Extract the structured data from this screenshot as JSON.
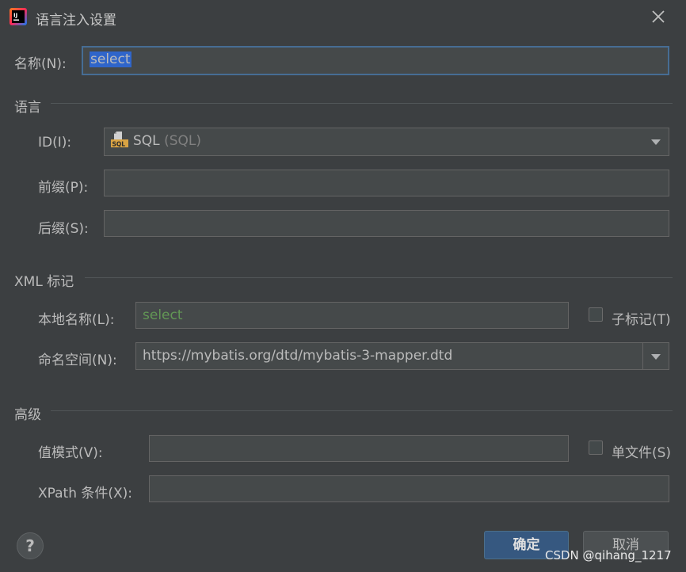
{
  "window": {
    "title": "语言注入设置",
    "app_icon": "intellij-idea-icon",
    "close_icon": "close-icon"
  },
  "name_row": {
    "label": "名称(N):",
    "value": "select",
    "value_selected": true
  },
  "language_section": {
    "title": "语言",
    "id_label": "ID(I):",
    "id_value_name": "SQL",
    "id_value_detail": "(SQL)",
    "id_icon": "sql-file-icon",
    "prefix_label": "前缀(P):",
    "prefix_value": "",
    "suffix_label": "后缀(S):",
    "suffix_value": ""
  },
  "xml_section": {
    "title": "XML 标记",
    "local_name_label": "本地名称(L):",
    "local_name_value": "select",
    "sub_tags_label": "子标记(T)",
    "sub_tags_checked": false,
    "namespace_label": "命名空间(N):",
    "namespace_value": "https://mybatis.org/dtd/mybatis-3-mapper.dtd"
  },
  "advanced_section": {
    "title": "高级",
    "value_pattern_label": "值模式(V):",
    "value_pattern_value": "",
    "single_file_label": "单文件(S)",
    "single_file_checked": false,
    "xpath_label": "XPath 条件(X):",
    "xpath_value": ""
  },
  "buttons": {
    "help": "?",
    "ok": "确定",
    "cancel": "取消"
  },
  "watermark": "CSDN @qihang_1217",
  "colors": {
    "background": "#3c3f41",
    "field_bg": "#45494a",
    "focus_border": "#466d94",
    "selection": "#2f65ca",
    "ok_button": "#365880",
    "green_text": "#629755"
  }
}
